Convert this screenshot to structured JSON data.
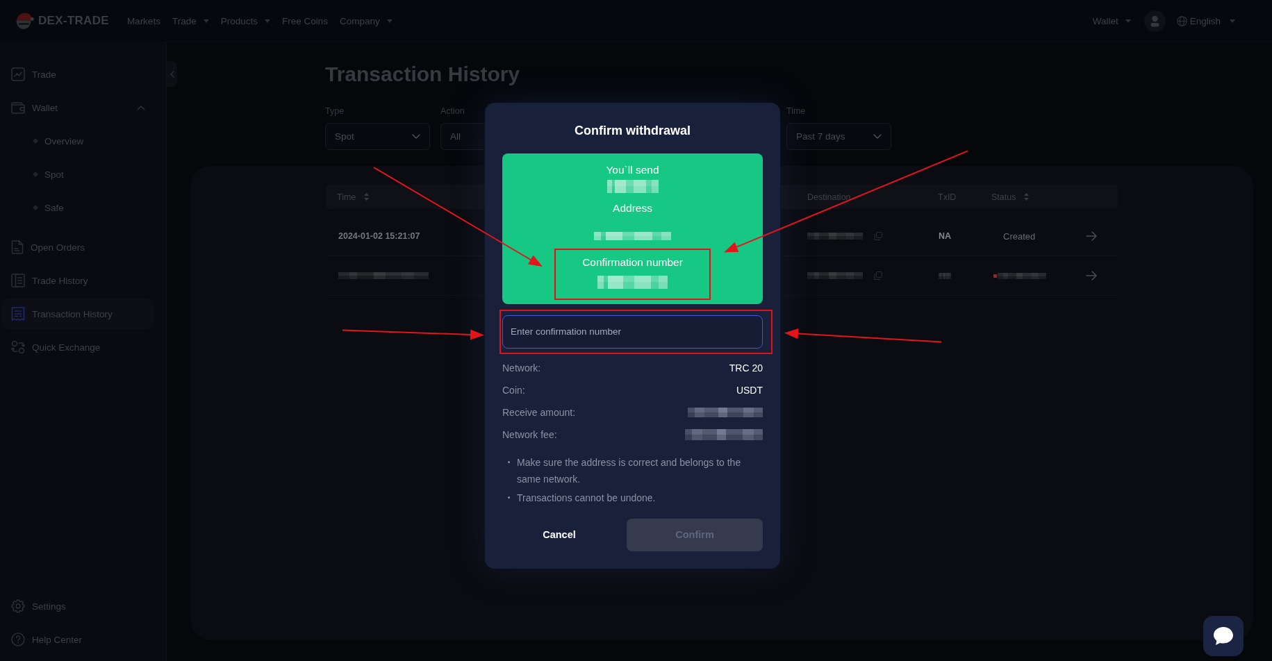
{
  "top_nav": {
    "logo": "DEX-TRADE",
    "links": [
      {
        "label": "Markets",
        "has_menu": false
      },
      {
        "label": "Trade",
        "has_menu": true
      },
      {
        "label": "Products",
        "has_menu": true
      },
      {
        "label": "Free Coins",
        "has_menu": false
      },
      {
        "label": "Company",
        "has_menu": true
      }
    ],
    "wallet_menu": {
      "label": "Wallet",
      "has_menu": true
    },
    "language": {
      "label": "English",
      "has_menu": true
    }
  },
  "sidebar": {
    "items": [
      {
        "label": "Trade",
        "selected": false
      },
      {
        "label": "Wallet",
        "selected": false,
        "expanded": true,
        "children": [
          {
            "label": "Overview",
            "selected": false
          },
          {
            "label": "Spot",
            "selected": false
          },
          {
            "label": "Safe",
            "selected": false
          }
        ]
      },
      {
        "label": "Open Orders",
        "selected": false
      },
      {
        "label": "Trade History",
        "selected": false
      },
      {
        "label": "Transaction History",
        "selected": true
      },
      {
        "label": "Quick Exchange",
        "selected": false
      }
    ],
    "footer_items": [
      {
        "label": "Settings",
        "selected": false
      },
      {
        "label": "Help Center",
        "selected": false
      }
    ]
  },
  "page": {
    "title": "Transaction History",
    "filters": [
      {
        "label": "Type",
        "value": "Spot",
        "show_chevron": true
      },
      {
        "label": "Action",
        "value": "All",
        "show_chevron": false
      },
      {
        "label": "Time",
        "value": "Past 7 days",
        "show_chevron": true
      }
    ],
    "table": {
      "columns": [
        {
          "label": "Time",
          "sortable": true
        },
        {
          "label": "Destination",
          "sortable": false
        },
        {
          "label": "TxID",
          "sortable": false
        },
        {
          "label": "Status",
          "sortable": true
        }
      ],
      "rows": [
        {
          "time": {
            "text": "2024-01-02 15:21:07",
            "redacted": false
          },
          "destination": {
            "redacted": true
          },
          "txid": {
            "text": "NA",
            "redacted": false
          },
          "status": {
            "text": "Created",
            "redacted": false
          }
        },
        {
          "time": {
            "redacted": true
          },
          "destination": {
            "redacted": true
          },
          "txid": {
            "redacted": true
          },
          "status": {
            "redacted": true,
            "color": "#8c2b2b"
          }
        }
      ]
    }
  },
  "dialog": {
    "title": "Confirm withdrawal",
    "summary": [
      {
        "label": "You`ll send",
        "redacted": true,
        "highlighted": false
      },
      {
        "label": "Address",
        "redacted": true,
        "highlighted": false
      },
      {
        "label": "Confirmation number",
        "redacted": true,
        "highlighted": true
      }
    ],
    "confirmation_field": {
      "placeholder": "Enter confirmation number",
      "focused": true,
      "highlighted": true
    },
    "details": [
      {
        "label": "Network:",
        "value": "TRC 20",
        "redacted": false
      },
      {
        "label": "Coin:",
        "value": "USDT",
        "redacted": false
      },
      {
        "label": "Receive amount:",
        "redacted": true
      },
      {
        "label": "Network fee:",
        "redacted": true
      }
    ],
    "notes": [
      "Make sure the address is correct and belongs to the same network.",
      "Transactions cannot be undone."
    ],
    "buttons": [
      {
        "label": "Cancel",
        "kind": "text",
        "disabled": false
      },
      {
        "label": "Confirm",
        "kind": "primary",
        "disabled": true
      }
    ]
  }
}
